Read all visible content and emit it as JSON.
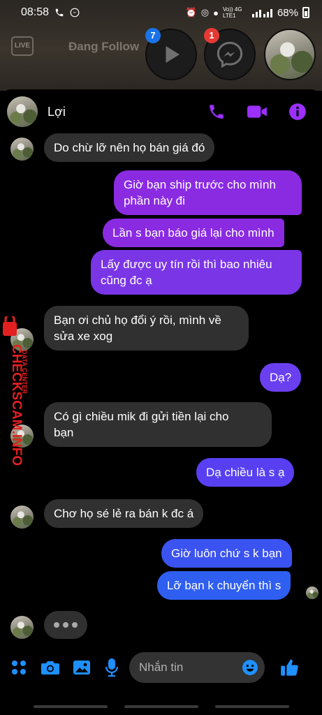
{
  "status_bar": {
    "time": "08:58",
    "network_label": "Vo)) 4G LTE1",
    "battery": "68%"
  },
  "background_app": {
    "live_icon": "LIVE",
    "text": "Đang Follow"
  },
  "chat_heads": [
    {
      "name": "video-app-head",
      "badge": "7",
      "badge_color": "#1a73e8"
    },
    {
      "name": "messenger-head",
      "badge": "1",
      "badge_color": "#e53935"
    },
    {
      "name": "contact-head",
      "badge": ""
    }
  ],
  "chat": {
    "contact_name": "Lợi",
    "accent_color": "#8a2be2",
    "header_actions": [
      "phone-icon",
      "video-call-icon",
      "info-icon"
    ],
    "messages": [
      {
        "dir": "in",
        "text": "Do chừ lỡ nên họ bán giá đó",
        "avatar": true
      },
      {
        "dir": "out",
        "text": "Giờ bạn ship trước cho mình\nphần này đi"
      },
      {
        "dir": "out",
        "text": "Lần s bạn báo giá lại cho mình"
      },
      {
        "dir": "out",
        "text": "Lấy được uy tín rồi thì bao nhiêu\ncũng đc ạ"
      },
      {
        "dir": "in",
        "text": "Bạn ơi chủ họ đổi ý rồi, mình về\nsửa xe xog",
        "avatar": true
      },
      {
        "dir": "out",
        "text": "Dạ?"
      },
      {
        "dir": "in",
        "text": "Có gì chiều mik đi gửi tiền lại cho\nbạn",
        "avatar": true
      },
      {
        "dir": "out",
        "text": "Dạ chiều là s ạ"
      },
      {
        "dir": "in",
        "text": "Chơ họ sé lẻ ra bán k đc á",
        "avatar": true
      },
      {
        "dir": "out",
        "text": "Giờ luôn chứ s k bạn"
      },
      {
        "dir": "out",
        "text": "Lỡ bạn k chuyển thì s",
        "seen": true
      }
    ],
    "typing_indicator": true
  },
  "watermark": {
    "brand": "CHECKSCAM.INFO",
    "sub": "DATA CENTER"
  },
  "composer": {
    "placeholder": "Nhắn tin",
    "icons": [
      "apps-icon",
      "camera-icon",
      "image-icon",
      "microphone-icon"
    ],
    "emoji_icon": "emoji-icon",
    "send_icon": "thumbs-up-icon",
    "icon_color": "#1e90ff"
  }
}
